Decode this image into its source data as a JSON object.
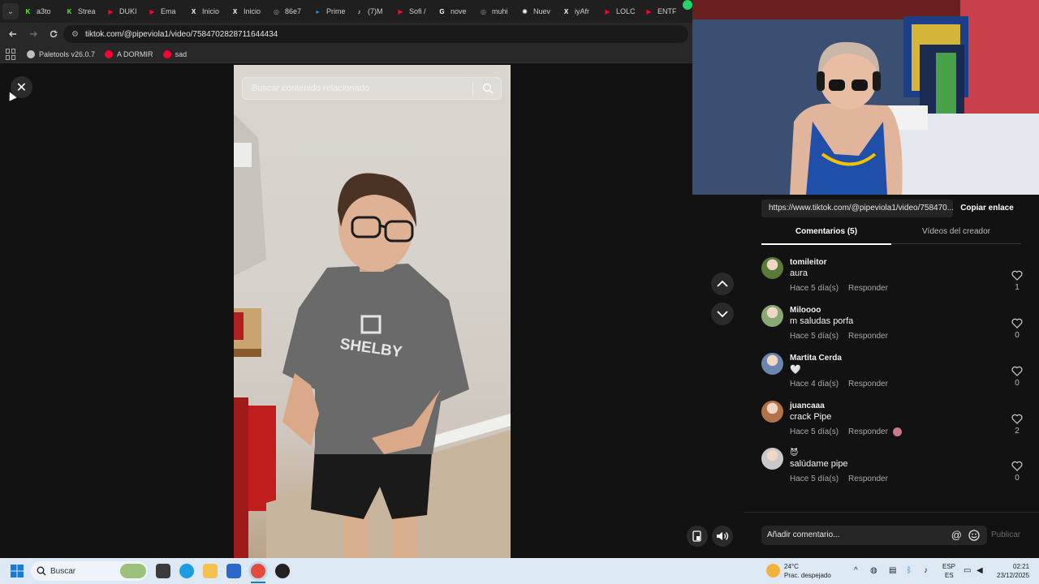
{
  "browser": {
    "tabs": [
      {
        "label": "a3to",
        "icon": "kick-icon",
        "color": "#53fc18"
      },
      {
        "label": "Strea",
        "icon": "kick-icon",
        "color": "#53fc18"
      },
      {
        "label": "DUKI",
        "icon": "youtube-icon",
        "color": "#ff0033"
      },
      {
        "label": "Ema",
        "icon": "youtube-icon",
        "color": "#ff0033"
      },
      {
        "label": "Inicio",
        "icon": "x-icon",
        "color": "#ffffff"
      },
      {
        "label": "Inicio",
        "icon": "x-icon",
        "color": "#ffffff"
      },
      {
        "label": "86e7",
        "icon": "globe-icon",
        "color": "#9a9a9a"
      },
      {
        "label": "Prime",
        "icon": "prime-icon",
        "color": "#1a98ff"
      },
      {
        "label": "(7)M",
        "icon": "tiktok-icon",
        "color": "#ffffff"
      },
      {
        "label": "Sofi /",
        "icon": "youtube-icon",
        "color": "#ff0033"
      },
      {
        "label": "nove",
        "icon": "google-icon",
        "color": "#ffffff"
      },
      {
        "label": "muhi",
        "icon": "globe-icon",
        "color": "#9a9a9a"
      },
      {
        "label": "Nuev",
        "icon": "chatgpt-icon",
        "color": "#ffffff"
      },
      {
        "label": "iyAfr",
        "icon": "x-icon",
        "color": "#ffffff"
      },
      {
        "label": "LOLC",
        "icon": "youtube-icon",
        "color": "#ff0033"
      },
      {
        "label": "ENTF",
        "icon": "youtube-icon",
        "color": "#ff0033"
      }
    ],
    "url": "tiktok.com/@pipeviola1/video/7584702828711644434",
    "bookmarks": [
      {
        "label": "Paletools v26.0.7",
        "color": "#bfbfbf"
      },
      {
        "label": "A DORMIR",
        "color": "#ff0033"
      },
      {
        "label": "sad",
        "color": "#ff0033"
      }
    ]
  },
  "video": {
    "search_placeholder": "Buscar contenido relacionado",
    "shirt_text": "SHELBY"
  },
  "panel": {
    "share_url": "https://www.tiktok.com/@pipeviola1/video/758470...",
    "copy_label": "Copiar enlace",
    "tab_comments": "Comentarios (5)",
    "tab_creator": "Vídeos del creador",
    "reply_label": "Responder",
    "comments": [
      {
        "user": "tomileitor",
        "text": "aura",
        "time": "Hace 5 día(s)",
        "likes": "1",
        "avatar_color": "#5a7a3a"
      },
      {
        "user": "Miloooo",
        "text": "m saludas porfa",
        "time": "Hace 5 día(s)",
        "likes": "0",
        "avatar_color": "#8aa876"
      },
      {
        "user": "Martita Cerda",
        "text": "🤍",
        "time": "Hace 4 día(s)",
        "likes": "0",
        "avatar_color": "#6b86b0"
      },
      {
        "user": "juancaaa",
        "text": "crack Pipe",
        "time": "Hace 5 día(s)",
        "likes": "2",
        "avatar_color": "#b0734a"
      },
      {
        "user": "😈",
        "text": "salúdame pipe",
        "time": "Hace 5 día(s)",
        "likes": "0",
        "avatar_color": "#c9c9c9"
      }
    ],
    "add_comment_placeholder": "Añadir comentario...",
    "publish_label": "Publicar"
  },
  "taskbar": {
    "search_label": "Buscar",
    "weather_temp": "24°C",
    "weather_desc": "Prac. despejado",
    "lang_top": "ESP",
    "lang_bottom": "ES",
    "time": "02:21",
    "date": "23/12/2025"
  }
}
